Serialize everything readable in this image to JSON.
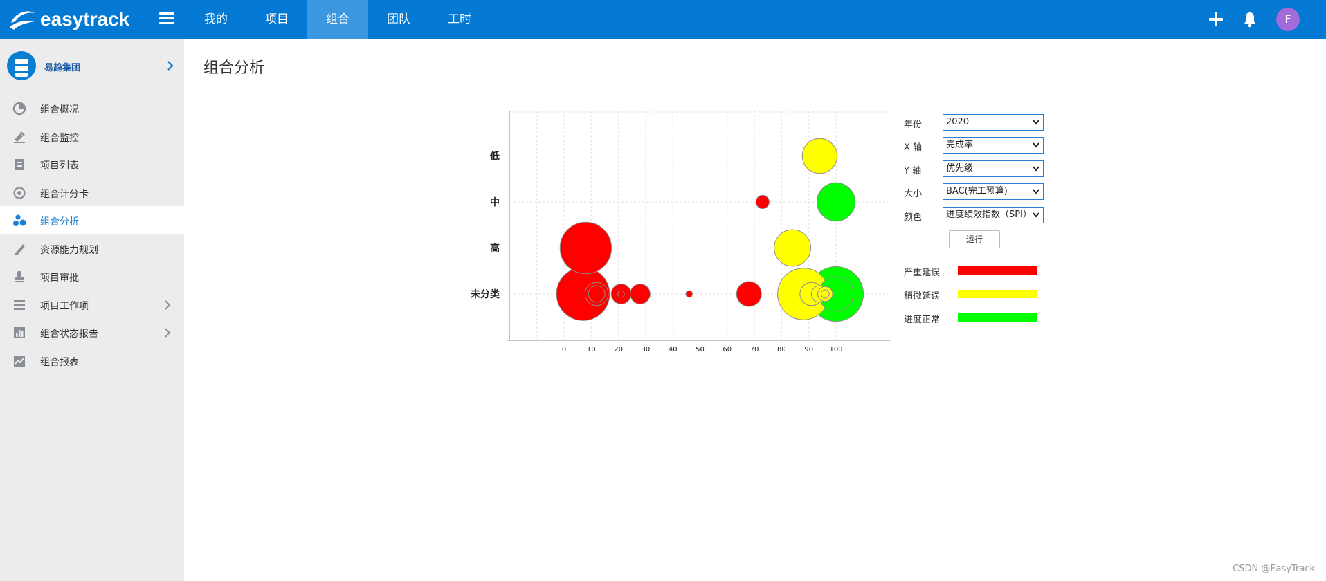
{
  "header": {
    "logo_text": "easytrack",
    "nav": [
      {
        "label": "我的",
        "active": false
      },
      {
        "label": "项目",
        "active": false
      },
      {
        "label": "组合",
        "active": true
      },
      {
        "label": "团队",
        "active": false
      },
      {
        "label": "工时",
        "active": false
      }
    ],
    "avatar_initial": "F",
    "brand_color": "#0479d4"
  },
  "sidebar": {
    "org_name": "易趋集团",
    "items": [
      {
        "label": "组合概况",
        "icon": "pie-icon"
      },
      {
        "label": "组合监控",
        "icon": "monitor-icon"
      },
      {
        "label": "项目列表",
        "icon": "list-icon"
      },
      {
        "label": "组合计分卡",
        "icon": "target-icon"
      },
      {
        "label": "组合分析",
        "icon": "bubbles-icon",
        "active": true
      },
      {
        "label": "资源能力规划",
        "icon": "ruler-icon"
      },
      {
        "label": "项目审批",
        "icon": "stamp-icon"
      },
      {
        "label": "项目工作项",
        "icon": "rows-icon",
        "expandable": true
      },
      {
        "label": "组合状态报告",
        "icon": "bar-report-icon",
        "expandable": true
      },
      {
        "label": "组合报表",
        "icon": "report-icon"
      }
    ]
  },
  "main": {
    "title": "组合分析"
  },
  "controls": {
    "year": {
      "label": "年份",
      "value": "2020"
    },
    "x_axis": {
      "label": "X 轴",
      "value": "完成率"
    },
    "y_axis": {
      "label": "Y 轴",
      "value": "优先级"
    },
    "size": {
      "label": "大小",
      "value": "BAC(完工预算)"
    },
    "color": {
      "label": "颜色",
      "value": "进度绩效指数（SPI）"
    },
    "run_label": "运行"
  },
  "legend": [
    {
      "label": "严重延误",
      "color": "#ff0000"
    },
    {
      "label": "稍微延误",
      "color": "#ffff00"
    },
    {
      "label": "进度正常",
      "color": "#00ff00"
    }
  ],
  "chart_data": {
    "type": "scatter",
    "xlabel": "",
    "ylabel": "",
    "x_ticks": [
      0,
      10,
      20,
      30,
      40,
      50,
      60,
      70,
      80,
      90,
      100
    ],
    "y_categories": [
      "未分类",
      "高",
      "中",
      "低"
    ],
    "points": [
      {
        "x": 94,
        "y": "低",
        "size": 0.42,
        "status": "稍微延误"
      },
      {
        "x": 73,
        "y": "中",
        "size": 0.16,
        "status": "严重延误"
      },
      {
        "x": 100,
        "y": "中",
        "size": 0.46,
        "status": "进度正常"
      },
      {
        "x": 8,
        "y": "高",
        "size": 0.62,
        "status": "严重延误"
      },
      {
        "x": 84,
        "y": "高",
        "size": 0.44,
        "status": "稍微延误"
      },
      {
        "x": 7,
        "y": "未分类",
        "size": 0.64,
        "status": "严重延误"
      },
      {
        "x": 12,
        "y": "未分类",
        "size": 0.28,
        "status": "严重延误"
      },
      {
        "x": 12,
        "y": "未分类",
        "size": 0.2,
        "status": "严重延误"
      },
      {
        "x": 21,
        "y": "未分类",
        "size": 0.24,
        "status": "严重延误"
      },
      {
        "x": 21,
        "y": "未分类",
        "size": 0.08,
        "status": "严重延误"
      },
      {
        "x": 28,
        "y": "未分类",
        "size": 0.24,
        "status": "严重延误"
      },
      {
        "x": 46,
        "y": "未分类",
        "size": 0.08,
        "status": "严重延误"
      },
      {
        "x": 68,
        "y": "未分类",
        "size": 0.3,
        "status": "严重延误"
      },
      {
        "x": 100,
        "y": "未分类",
        "size": 0.66,
        "status": "进度正常"
      },
      {
        "x": 100,
        "y": "未分类",
        "size": 0.42,
        "status": "进度正常"
      },
      {
        "x": 88,
        "y": "未分类",
        "size": 0.62,
        "status": "稍微延误"
      },
      {
        "x": 91,
        "y": "未分类",
        "size": 0.28,
        "status": "稍微延误"
      },
      {
        "x": 94,
        "y": "未分类",
        "size": 0.2,
        "status": "稍微延误"
      },
      {
        "x": 96,
        "y": "未分类",
        "size": 0.18,
        "status": "稍微延误"
      },
      {
        "x": 96,
        "y": "未分类",
        "size": 0.1,
        "status": "稍微延误"
      }
    ],
    "grid": true
  },
  "watermark": "CSDN @EasyTrack"
}
